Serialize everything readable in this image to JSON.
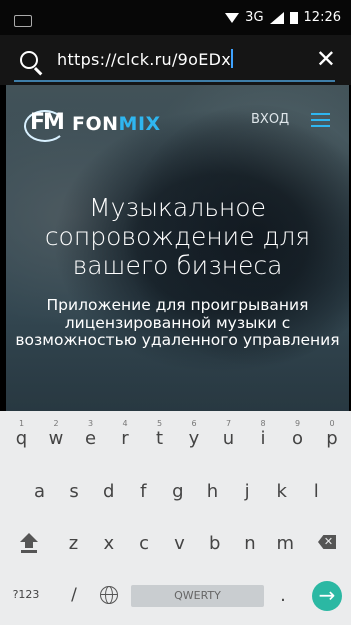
{
  "status_bar": {
    "network": "3G",
    "time": "12:26"
  },
  "url_bar": {
    "url": "https://clck.ru/9oEDx"
  },
  "web": {
    "logo": {
      "mark": "FM",
      "part1": "FON",
      "part2": "MIX"
    },
    "login_label": "ВХОД",
    "headline": "Музыкальное сопровождение для вашего бизнеса",
    "subtitle": "Приложение для проигрывания лицензированной музыки с возможностью удаленного управления"
  },
  "keyboard": {
    "row1": [
      {
        "key": "q",
        "num": "1"
      },
      {
        "key": "w",
        "num": "2"
      },
      {
        "key": "e",
        "num": "3"
      },
      {
        "key": "r",
        "num": "4"
      },
      {
        "key": "t",
        "num": "5"
      },
      {
        "key": "y",
        "num": "6"
      },
      {
        "key": "u",
        "num": "7"
      },
      {
        "key": "i",
        "num": "8"
      },
      {
        "key": "o",
        "num": "9"
      },
      {
        "key": "p",
        "num": "0"
      }
    ],
    "row2": [
      "a",
      "s",
      "d",
      "f",
      "g",
      "h",
      "j",
      "k",
      "l"
    ],
    "row3": [
      "z",
      "x",
      "c",
      "v",
      "b",
      "n",
      "m"
    ],
    "symbols_label": "?123",
    "slash_label": "/",
    "space_label": "QWERTY",
    "period_label": ".",
    "enter_icon": "→"
  }
}
